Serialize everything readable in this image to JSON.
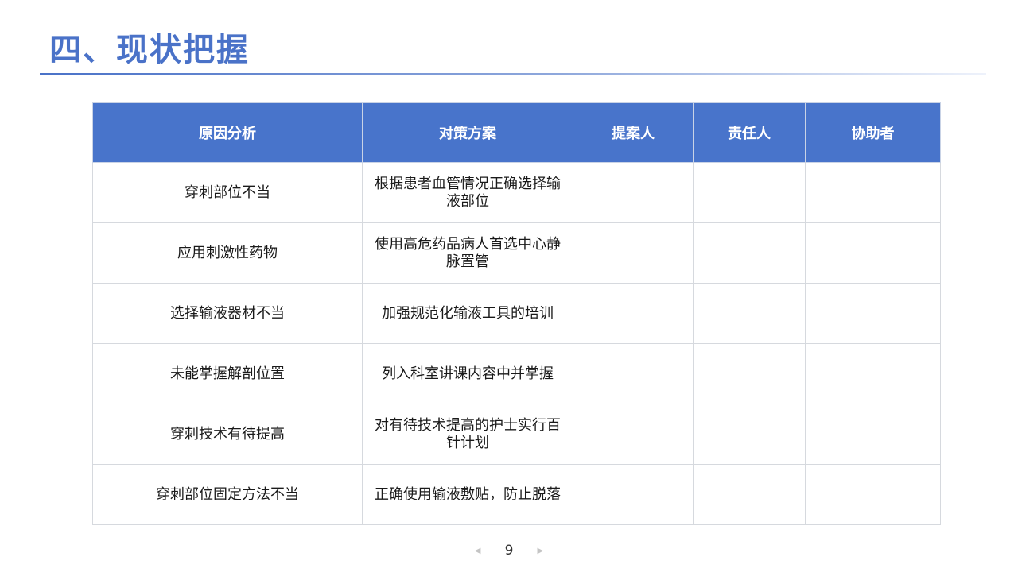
{
  "slide": {
    "title": "四、现状把握",
    "page_number": "9",
    "accent_color": "#4a72c8",
    "prev_icon": "triangle-left-icon",
    "next_icon": "triangle-right-icon"
  },
  "table": {
    "headers": [
      "原因分析",
      "对策方案",
      "提案人",
      "责任人",
      "协助者"
    ],
    "rows": [
      {
        "cause": "穿刺部位不当",
        "measure": "根据患者血管情况正确选择输液部位",
        "proposer": "",
        "owner": "",
        "assistant": ""
      },
      {
        "cause": "应用刺激性药物",
        "measure": "使用高危药品病人首选中心静脉置管",
        "proposer": "",
        "owner": "",
        "assistant": ""
      },
      {
        "cause": "选择输液器材不当",
        "measure": "加强规范化输液工具的培训",
        "proposer": "",
        "owner": "",
        "assistant": ""
      },
      {
        "cause": "未能掌握解剖位置",
        "measure": "列入科室讲课内容中并掌握",
        "proposer": "",
        "owner": "",
        "assistant": ""
      },
      {
        "cause": "穿刺技术有待提高",
        "measure": "对有待技术提高的护士实行百针计划",
        "proposer": "",
        "owner": "",
        "assistant": ""
      },
      {
        "cause": "穿刺部位固定方法不当",
        "measure": "正确使用输液敷贴，防止脱落",
        "proposer": "",
        "owner": "",
        "assistant": ""
      }
    ]
  }
}
